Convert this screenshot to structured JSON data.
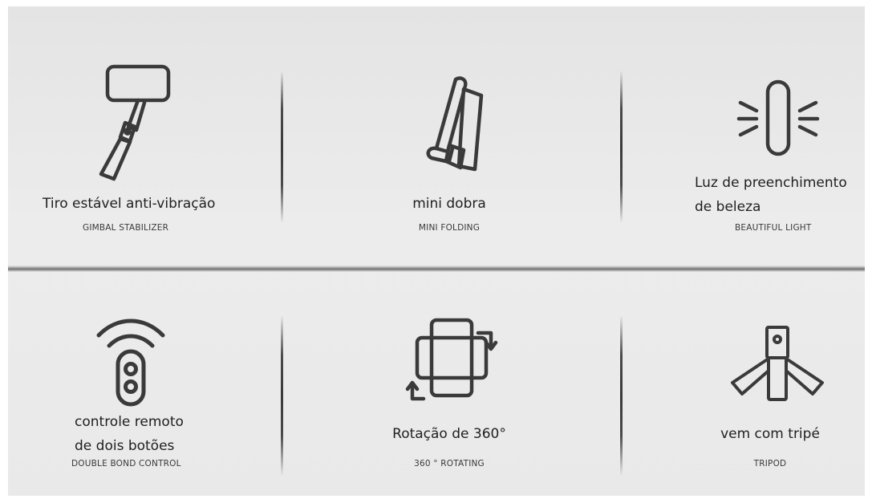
{
  "features": [
    {
      "id": "gimbal",
      "title": "Tiro estável anti-vibração",
      "subtitle": "GIMBAL  STABILIZER",
      "icon": "selfie-stick-icon"
    },
    {
      "id": "folding",
      "title": "mini dobra",
      "subtitle": "MINI FOLDING",
      "icon": "folding-icon"
    },
    {
      "id": "light",
      "title_line1": "Luz de preenchimento",
      "title_line2": "de beleza",
      "subtitle": "BEAUTIFUL LIGHT",
      "icon": "fill-light-icon"
    },
    {
      "id": "remote",
      "title_line1": "controle remoto",
      "title_line2": "de dois botões",
      "subtitle": "DOUBLE BOND CONTROL",
      "icon": "remote-control-icon"
    },
    {
      "id": "rotation",
      "title": "Rotação de 360°",
      "subtitle": "360 ° ROTATING",
      "icon": "rotation-icon"
    },
    {
      "id": "tripod",
      "title": "vem com tripé",
      "subtitle": "TRIPOD",
      "icon": "tripod-icon"
    }
  ],
  "colors": {
    "background": "#e9e9e9",
    "icon": "#3a3a3a",
    "text": "#1f1f1f"
  }
}
